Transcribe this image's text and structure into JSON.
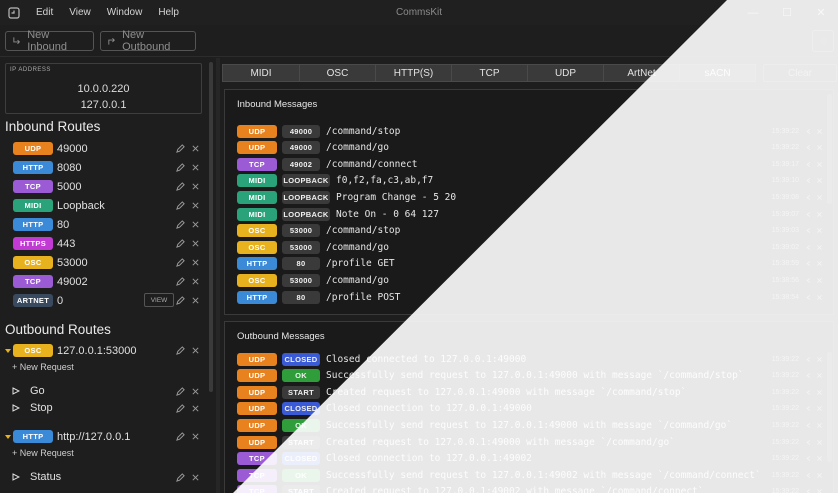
{
  "colors": {
    "udp": "#e8821e",
    "http": "#3a8ad8",
    "tcp": "#9b5bd4",
    "midi": "#2aa37a",
    "https": "#c23ad4",
    "osc": "#e8b21e",
    "artnet": "#3a4a5e",
    "closed": "#3b5bd6",
    "ok": "#2f9e3a",
    "start": "#3a3a3a"
  },
  "window": {
    "title": "CommsKit",
    "menu": [
      "Edit",
      "View",
      "Window",
      "Help"
    ],
    "controls": {
      "minimize": "—",
      "maximize": "☐",
      "close": "✕"
    }
  },
  "toolbar": {
    "new_inbound": "New Inbound",
    "new_outbound": "New Outbound",
    "settings_icon": "gear-icon"
  },
  "sidebar": {
    "ip_label": "IP ADDRESS",
    "ips": [
      "10.0.0.220",
      "127.0.0.1"
    ],
    "inbound_title": "Inbound Routes",
    "inbound": [
      {
        "proto": "UDP",
        "color": "udp",
        "value": "49000"
      },
      {
        "proto": "HTTP",
        "color": "http",
        "value": "8080"
      },
      {
        "proto": "TCP",
        "color": "tcp",
        "value": "5000"
      },
      {
        "proto": "MIDI",
        "color": "midi",
        "value": "Loopback"
      },
      {
        "proto": "HTTP",
        "color": "http",
        "value": "80"
      },
      {
        "proto": "HTTPS",
        "color": "https",
        "value": "443"
      },
      {
        "proto": "OSC",
        "color": "osc",
        "value": "53000"
      },
      {
        "proto": "TCP",
        "color": "tcp",
        "value": "49002"
      },
      {
        "proto": "ARTNET",
        "color": "artnet",
        "value": "0",
        "view": "VIEW"
      }
    ],
    "outbound_title": "Outbound Routes",
    "outbound": [
      {
        "proto": "OSC",
        "color": "osc",
        "value": "127.0.0.1:53000",
        "new_request": "New Request",
        "requests": [
          "Go",
          "Stop"
        ]
      },
      {
        "proto": "HTTP",
        "color": "http",
        "value": "http://127.0.0.1",
        "new_request": "New Request",
        "requests": [
          "Status"
        ]
      }
    ]
  },
  "main": {
    "tabs": [
      "MIDI",
      "OSC",
      "HTTP(S)",
      "TCP",
      "UDP",
      "ArtNet",
      "sACN"
    ],
    "clear": "Clear",
    "inbound_title": "Inbound Messages",
    "inbound_messages": [
      {
        "proto": "UDP",
        "color": "udp",
        "tag": "49000",
        "text": "/command/stop",
        "time": "15:39:22"
      },
      {
        "proto": "UDP",
        "color": "udp",
        "tag": "49000",
        "text": "/command/go",
        "time": "15:39:22"
      },
      {
        "proto": "TCP",
        "color": "tcp",
        "tag": "49002",
        "text": "/command/connect",
        "time": "15:39:17"
      },
      {
        "proto": "MIDI",
        "color": "midi",
        "tag": "LOOPBACK",
        "text": "f0,f2,fa,c3,ab,f7",
        "time": "15:39:10"
      },
      {
        "proto": "MIDI",
        "color": "midi",
        "tag": "LOOPBACK",
        "text": "Program Change - 5 20",
        "time": "15:39:08"
      },
      {
        "proto": "MIDI",
        "color": "midi",
        "tag": "LOOPBACK",
        "text": "Note On - 0 64 127",
        "time": "15:39:07"
      },
      {
        "proto": "OSC",
        "color": "osc",
        "tag": "53000",
        "text": "/command/stop",
        "time": "15:39:03"
      },
      {
        "proto": "OSC",
        "color": "osc",
        "tag": "53000",
        "text": "/command/go",
        "time": "15:39:02"
      },
      {
        "proto": "HTTP",
        "color": "http",
        "tag": "80",
        "text": "/profile GET",
        "time": "15:38:59"
      },
      {
        "proto": "OSC",
        "color": "osc",
        "tag": "53000",
        "text": "/command/go",
        "time": "15:38:56"
      },
      {
        "proto": "HTTP",
        "color": "http",
        "tag": "80",
        "text": "/profile POST",
        "time": "15:38:54"
      }
    ],
    "outbound_title": "Outbound Messages",
    "outbound_messages": [
      {
        "proto": "UDP",
        "color": "udp",
        "status": "CLOSED",
        "scolor": "closed",
        "text": "Closed connected to 127.0.0.1:49000",
        "time": "15:39:22"
      },
      {
        "proto": "UDP",
        "color": "udp",
        "status": "OK",
        "scolor": "ok",
        "text": "Successfully send request to 127.0.0.1:49000 with message `/command/stop`",
        "time": "15:39:22"
      },
      {
        "proto": "UDP",
        "color": "udp",
        "status": "START",
        "scolor": "start",
        "text": "Created request to 127.0.0.1:49000 with message `/command/stop`",
        "time": "15:39:22"
      },
      {
        "proto": "UDP",
        "color": "udp",
        "status": "CLOSED",
        "scolor": "closed",
        "text": "Closed connection to 127.0.0.1:49000",
        "time": "15:39:22"
      },
      {
        "proto": "UDP",
        "color": "udp",
        "status": "OK",
        "scolor": "ok",
        "text": "Successfully send request to 127.0.0.1:49000 with message `/command/go`",
        "time": "15:39:22"
      },
      {
        "proto": "UDP",
        "color": "udp",
        "status": "START",
        "scolor": "start",
        "text": "Created request to 127.0.0.1:49000 with message `/command/go`",
        "time": "15:39:22"
      },
      {
        "proto": "TCP",
        "color": "tcp",
        "status": "CLOSED",
        "scolor": "closed",
        "text": "Closed connection to 127.0.0.1:49002",
        "time": "15:39:22"
      },
      {
        "proto": "TCP",
        "color": "tcp",
        "status": "OK",
        "scolor": "ok",
        "text": "Successfully send request to 127.0.0.1:49002 with message `/command/connect`",
        "time": "15:39:22"
      },
      {
        "proto": "TCP",
        "color": "tcp",
        "status": "START",
        "scolor": "start",
        "text": "Created request to 127.0.0.1:49002 with message `/command/connect`",
        "time": "15:39:22"
      }
    ]
  }
}
